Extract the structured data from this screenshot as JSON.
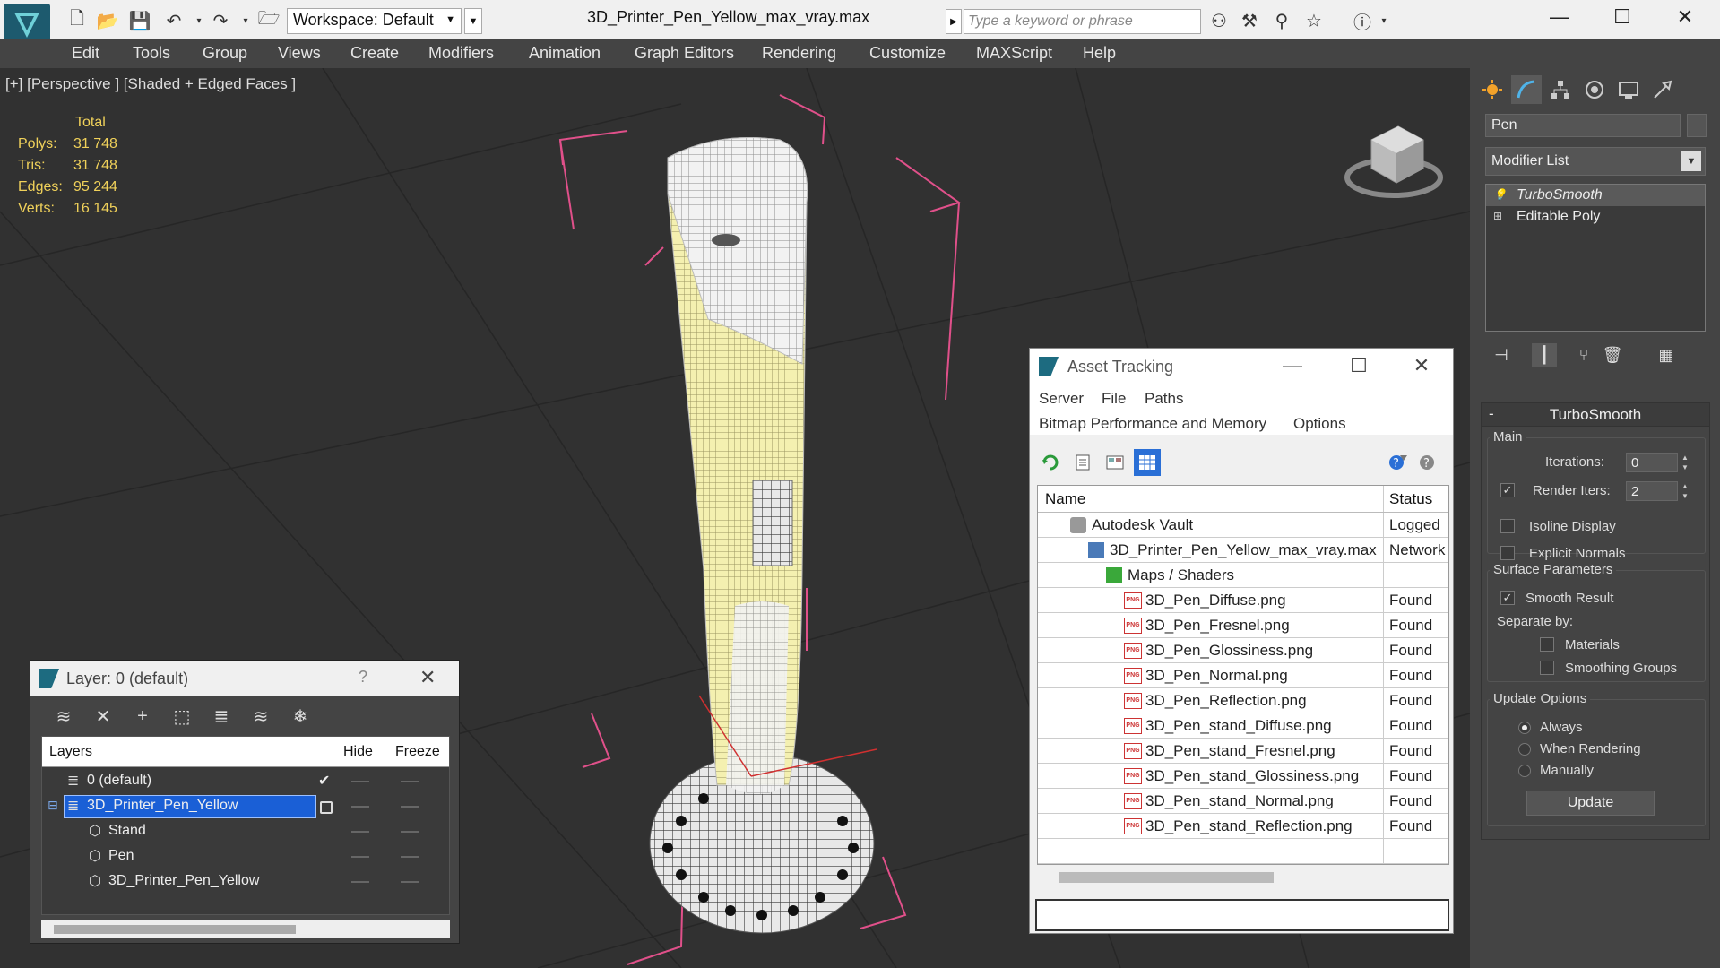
{
  "titlebar": {
    "workspace": "Workspace: Default",
    "doc_title": "3D_Printer_Pen_Yellow_max_vray.max",
    "search_placeholder": "Type a keyword or phrase",
    "minimize": "—",
    "maximize": "☐",
    "close": "✕"
  },
  "menu": [
    "Edit",
    "Tools",
    "Group",
    "Views",
    "Create",
    "Modifiers",
    "Animation",
    "Graph Editors",
    "Rendering",
    "Customize",
    "MAXScript",
    "Help"
  ],
  "viewport": {
    "label": "[+] [Perspective ] [Shaded + Edged Faces ]",
    "stats_header": "Total",
    "stats": [
      {
        "key": "Polys:",
        "value": "31 748"
      },
      {
        "key": "Tris:",
        "value": "31 748"
      },
      {
        "key": "Edges:",
        "value": "95 244"
      },
      {
        "key": "Verts:",
        "value": "16 145"
      }
    ],
    "wire_color": "#f4f0b0",
    "bbox_color": "#e0508a"
  },
  "command_panel": {
    "object_name": "Pen",
    "modifier_list": "Modifier List",
    "stack": [
      "TurboSmooth",
      "Editable Poly"
    ],
    "rollout_title": "TurboSmooth",
    "main_group": "Main",
    "iterations_label": "Iterations:",
    "iterations_value": "0",
    "render_iters_label": "Render Iters:",
    "render_iters_value": "2",
    "isoline_label": "Isoline Display",
    "explicit_normals_label": "Explicit Normals",
    "surface_group": "Surface Parameters",
    "smooth_result_label": "Smooth Result",
    "separate_by_label": "Separate by:",
    "materials_label": "Materials",
    "smoothing_groups_label": "Smoothing Groups",
    "update_group": "Update Options",
    "always_label": "Always",
    "when_rendering_label": "When Rendering",
    "manually_label": "Manually",
    "update_button": "Update"
  },
  "asset_tracking": {
    "title": "Asset Tracking",
    "menu": [
      "Server",
      "File",
      "Paths",
      "Bitmap Performance and Memory",
      "Options"
    ],
    "columns": [
      "Name",
      "Status"
    ],
    "rows": [
      {
        "name": "Autodesk Vault",
        "status": "Logged",
        "indent": 0,
        "icon": "vault-icon"
      },
      {
        "name": "3D_Printer_Pen_Yellow_max_vray.max",
        "status": "Network",
        "indent": 1,
        "icon": "max-file-icon"
      },
      {
        "name": "Maps / Shaders",
        "status": "",
        "indent": 2,
        "icon": "maps-icon"
      },
      {
        "name": "3D_Pen_Diffuse.png",
        "status": "Found",
        "indent": 3,
        "icon": "png-icon"
      },
      {
        "name": "3D_Pen_Fresnel.png",
        "status": "Found",
        "indent": 3,
        "icon": "png-icon"
      },
      {
        "name": "3D_Pen_Glossiness.png",
        "status": "Found",
        "indent": 3,
        "icon": "png-icon"
      },
      {
        "name": "3D_Pen_Normal.png",
        "status": "Found",
        "indent": 3,
        "icon": "png-icon"
      },
      {
        "name": "3D_Pen_Reflection.png",
        "status": "Found",
        "indent": 3,
        "icon": "png-icon"
      },
      {
        "name": "3D_Pen_stand_Diffuse.png",
        "status": "Found",
        "indent": 3,
        "icon": "png-icon"
      },
      {
        "name": "3D_Pen_stand_Fresnel.png",
        "status": "Found",
        "indent": 3,
        "icon": "png-icon"
      },
      {
        "name": "3D_Pen_stand_Glossiness.png",
        "status": "Found",
        "indent": 3,
        "icon": "png-icon"
      },
      {
        "name": "3D_Pen_stand_Normal.png",
        "status": "Found",
        "indent": 3,
        "icon": "png-icon"
      },
      {
        "name": "3D_Pen_stand_Reflection.png",
        "status": "Found",
        "indent": 3,
        "icon": "png-icon"
      }
    ]
  },
  "layer_dialog": {
    "title": "Layer: 0 (default)",
    "help": "?",
    "close": "✕",
    "columns": [
      "Layers",
      "Hide",
      "Freeze"
    ],
    "rows": [
      {
        "name": "0 (default)",
        "indent": 0,
        "selected": false
      },
      {
        "name": "3D_Printer_Pen_Yellow",
        "indent": 0,
        "selected": true
      },
      {
        "name": "Stand",
        "indent": 1,
        "selected": false
      },
      {
        "name": "Pen",
        "indent": 1,
        "selected": false
      },
      {
        "name": "3D_Printer_Pen_Yellow",
        "indent": 1,
        "selected": false
      }
    ]
  },
  "colors": {
    "selection_blue": "#1a5fd6",
    "stats_yellow": "#f0d15a"
  }
}
